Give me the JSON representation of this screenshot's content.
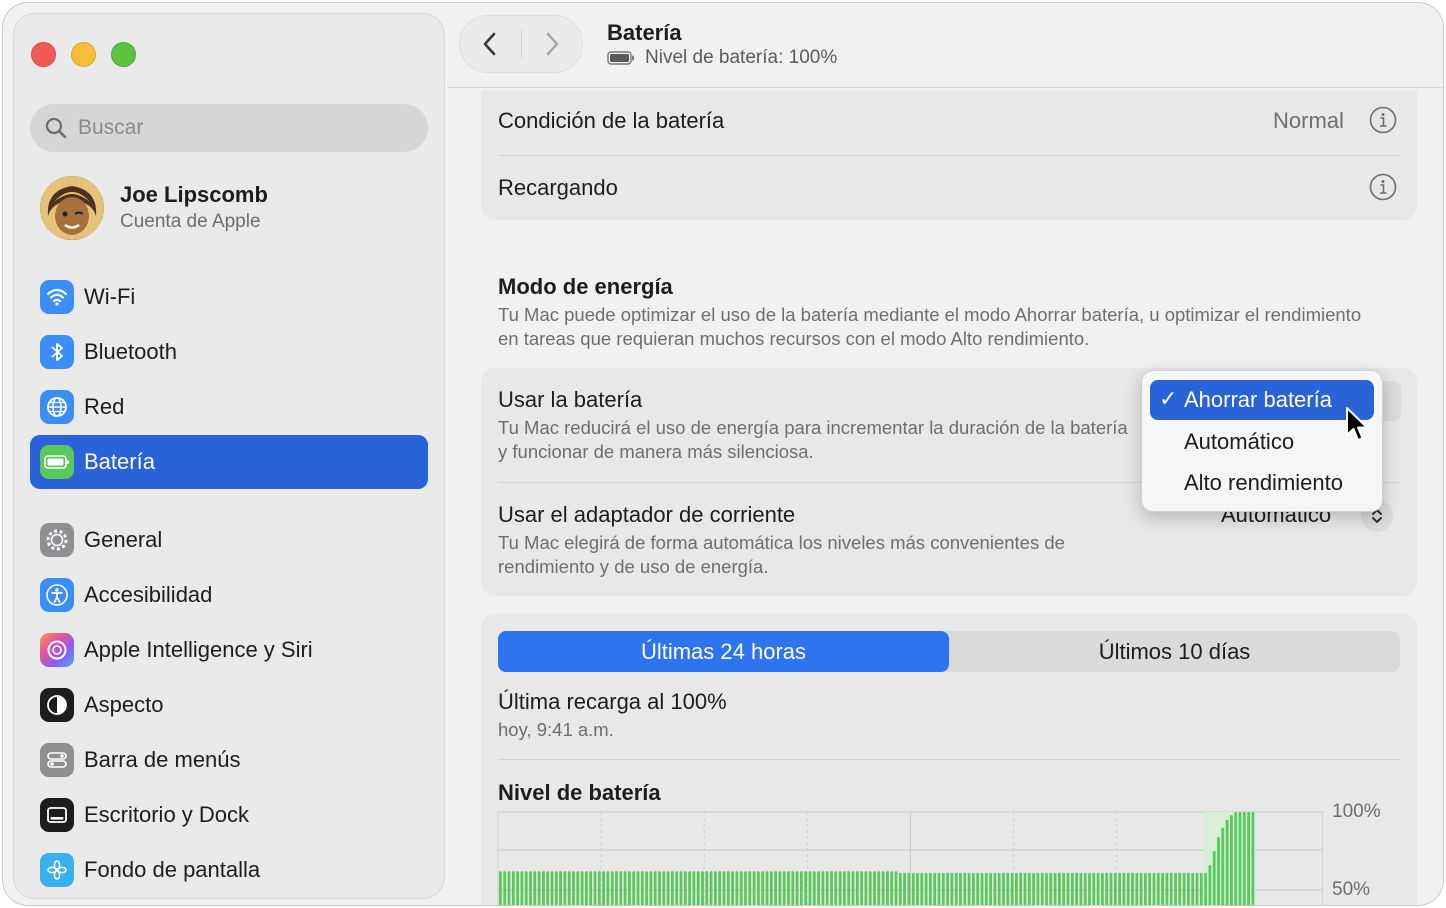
{
  "sidebar": {
    "search_placeholder": "Buscar",
    "account": {
      "name": "Joe Lipscomb",
      "subtitle": "Cuenta de Apple"
    },
    "items": [
      {
        "label": "Wi-Fi",
        "icon": "wifi-icon",
        "color": "#3a8ef6"
      },
      {
        "label": "Bluetooth",
        "icon": "bluetooth-icon",
        "color": "#3a8ef6"
      },
      {
        "label": "Red",
        "icon": "globe-icon",
        "color": "#3a8ef6"
      },
      {
        "label": "Batería",
        "icon": "battery-icon",
        "color": "#5ac85a",
        "selected": true
      },
      {
        "label": "General",
        "icon": "gear-icon",
        "color": "#8e8e93"
      },
      {
        "label": "Accesibilidad",
        "icon": "accessibility-icon",
        "color": "#3a8ef6"
      },
      {
        "label": "Apple Intelligence y Siri",
        "icon": "siri-icon",
        "color": "#d46cd8"
      },
      {
        "label": "Aspecto",
        "icon": "appearance-icon",
        "color": "#1d1d1f"
      },
      {
        "label": "Barra de menús",
        "icon": "menubar-icon",
        "color": "#8e8e93"
      },
      {
        "label": "Escritorio y Dock",
        "icon": "dock-icon",
        "color": "#1d1d1f"
      },
      {
        "label": "Fondo de pantalla",
        "icon": "wallpaper-icon",
        "color": "#3ab0f0"
      }
    ]
  },
  "header": {
    "title": "Batería",
    "subtitle": "Nivel de batería: 100%"
  },
  "health": {
    "condition_label": "Condición de la batería",
    "condition_value": "Normal",
    "charging_label": "Recargando"
  },
  "energy": {
    "title": "Modo de energía",
    "description": "Tu Mac puede optimizar el uso de la batería mediante el modo Ahorrar batería, u optimizar el rendimiento en tareas que requieran muchos recursos con el modo Alto rendimiento.",
    "battery_row": {
      "title": "Usar la batería",
      "description": "Tu Mac reducirá el uso de energía para incrementar la duración de la batería y funcionar de manera más silenciosa."
    },
    "adapter_row": {
      "title": "Usar el adaptador de corriente",
      "description": "Tu Mac elegirá de forma automática los niveles más convenientes de rendimiento y de uso de energía.",
      "value": "Automático"
    },
    "menu": {
      "options": [
        "Ahorrar batería",
        "Automático",
        "Alto rendimiento"
      ],
      "selected": "Ahorrar batería"
    }
  },
  "history": {
    "tabs": [
      "Últimas 24 horas",
      "Últimos 10 días"
    ],
    "active_tab": "Últimas 24 horas",
    "last_charge": "Última recarga al 100%",
    "last_charge_time": "hoy, 9:41 a.m.",
    "chart_title": "Nivel de batería",
    "accent": "#5ac85a"
  },
  "chart_data": {
    "type": "bar",
    "title": "Nivel de batería",
    "y_tick_labels": [
      "100%",
      "50%"
    ],
    "ylim": [
      0,
      100
    ],
    "values": [
      62,
      62,
      62,
      62,
      62,
      62,
      62,
      62,
      62,
      62,
      62,
      62,
      62,
      62,
      62,
      62,
      62,
      62,
      62,
      62,
      62,
      62,
      62,
      62,
      62,
      62,
      62,
      62,
      62,
      62,
      62,
      62,
      62,
      62,
      62,
      62,
      62,
      62,
      62,
      62,
      62,
      62,
      62,
      62,
      62,
      62,
      62,
      62,
      62,
      62,
      62,
      62,
      62,
      62,
      62,
      62,
      62,
      62,
      62,
      62,
      62,
      62,
      62,
      62,
      62,
      62,
      62,
      62,
      62,
      62,
      62,
      62,
      62,
      62,
      62,
      62,
      62,
      62,
      62,
      62,
      62,
      62,
      62,
      62,
      62,
      62,
      62,
      62,
      62,
      62,
      62,
      62,
      62,
      61,
      61,
      61,
      61,
      61,
      61,
      61,
      61,
      61,
      61,
      61,
      61,
      61,
      61,
      61,
      61,
      61,
      61,
      61,
      61,
      61,
      61,
      61,
      61,
      61,
      61,
      61,
      61,
      61,
      61,
      61,
      61,
      61,
      61,
      61,
      61,
      61,
      61,
      61,
      61,
      61,
      61,
      61,
      61,
      61,
      61,
      61,
      61,
      61,
      61,
      61,
      61,
      61,
      61,
      61,
      61,
      61,
      61,
      61,
      61,
      61,
      61,
      61,
      61,
      61,
      61,
      61,
      61,
      61,
      61,
      61,
      61,
      66,
      75,
      84,
      90,
      95,
      98,
      100,
      100,
      100,
      100,
      100
    ],
    "highlight_from_index": 164
  }
}
